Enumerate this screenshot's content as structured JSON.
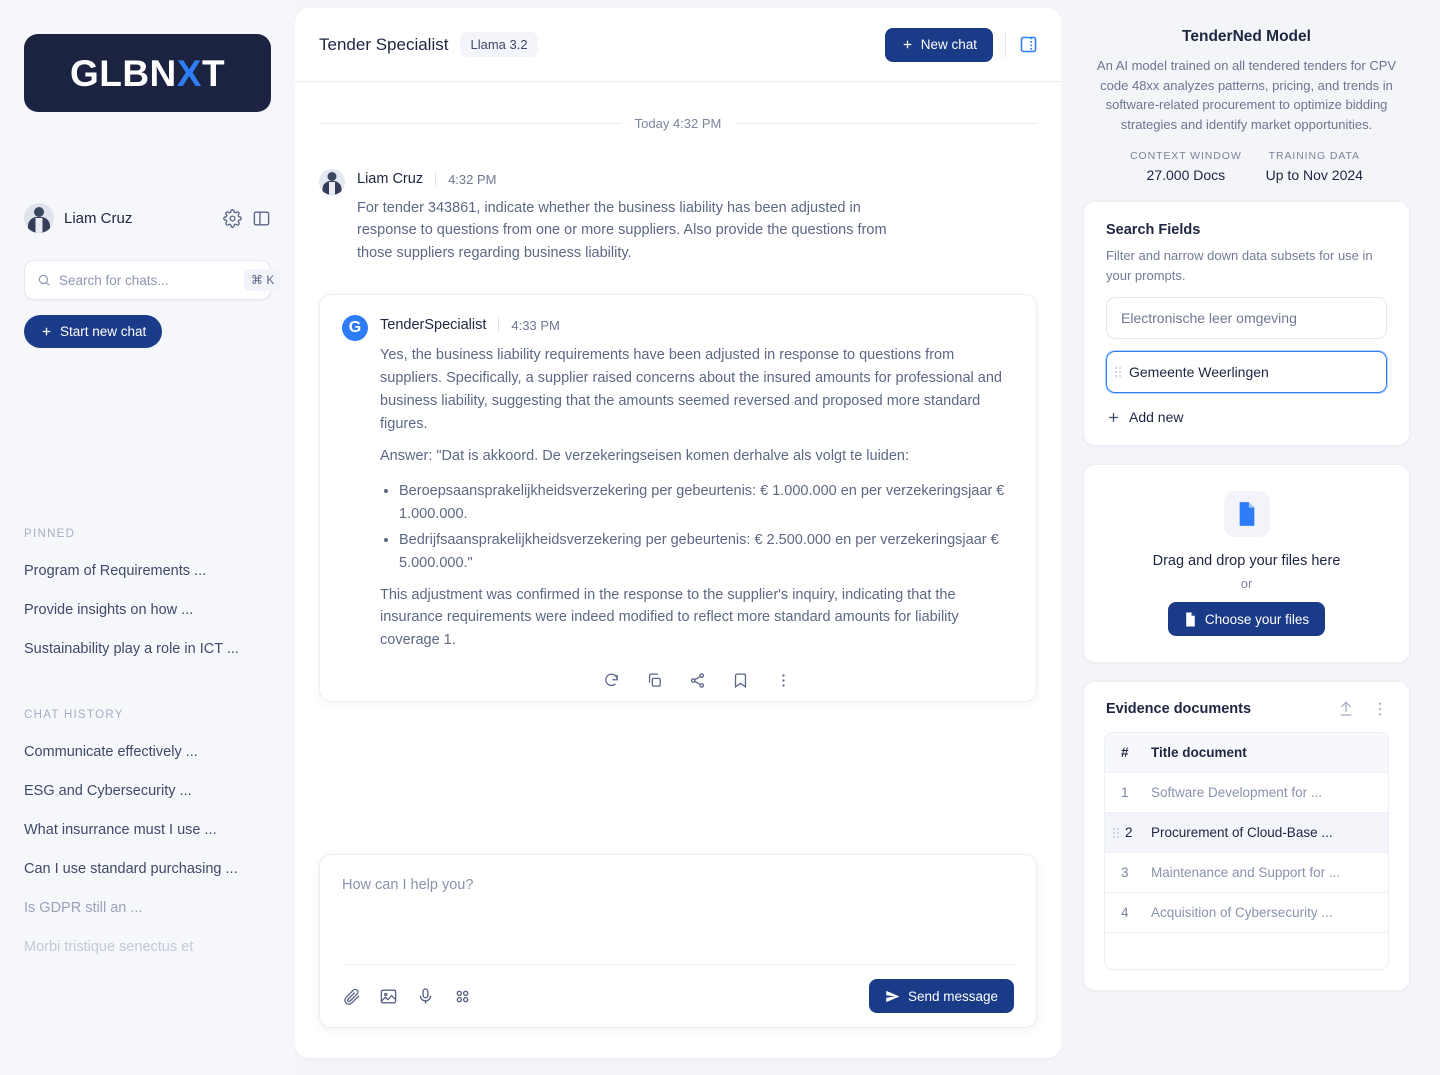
{
  "brand": {
    "logo_main": "GLBN",
    "logo_accent": "X",
    "logo_tail": "T"
  },
  "sidebar": {
    "user": {
      "name": "Liam Cruz"
    },
    "settings_icon": "gear-icon",
    "panel_icon": "panel-toggle-icon",
    "search": {
      "placeholder": "Search for chats...",
      "value": "",
      "shortcut": "⌘ K"
    },
    "start_chat_label": "Start new chat",
    "pinned_label": "PINNED",
    "pinned": [
      "Program of Requirements ...",
      "Provide insights on how ...",
      "Sustainability play a role in ICT ..."
    ],
    "history_label": "CHAT HISTORY",
    "history": [
      "Communicate effectively ...",
      "ESG and Cybersecurity ...",
      "What insurrance must I use ...",
      "Can I use standard purchasing ...",
      "Is GDPR still an ...",
      "Morbi tristique senectus et"
    ]
  },
  "chat": {
    "title": "Tender Specialist",
    "model_badge": "Llama 3.2",
    "new_chat_label": "New chat",
    "day_divider": "Today 4:32 PM",
    "user_message": {
      "author": "Liam Cruz",
      "time": "4:32 PM",
      "text": "For tender 343861, indicate whether the business liability has been adjusted in response to questions from one or more suppliers. Also provide the questions from those suppliers regarding business liability."
    },
    "bot_message": {
      "author": "TenderSpecialist",
      "time": "4:33 PM",
      "logo_letter": "G",
      "paragraph1": "Yes, the business liability requirements have been adjusted in response to questions from suppliers. Specifically, a supplier raised concerns about the insured amounts for professional and business liability, suggesting that the amounts seemed reversed and proposed more standard figures.",
      "paragraph2": "Answer: \"Dat is akkoord. De verzekeringseisen komen derhalve als volgt te luiden:",
      "bullets": [
        "Beroepsaansprakelijkheidsverzekering per gebeurtenis: € 1.000.000 en per verzekeringsjaar € 1.000.000.",
        "Bedrijfsaansprakelijkheidsverzekering per gebeurtenis: € 2.500.000 en per verzekeringsjaar € 5.000.000.\""
      ],
      "paragraph3": "This adjustment was confirmed in the response to the supplier's inquiry, indicating that the insurance requirements were indeed modified to reflect more standard amounts for liability coverage 1.",
      "actions": [
        "regenerate-icon",
        "copy-icon",
        "share-icon",
        "bookmark-icon",
        "more-options-icon"
      ]
    },
    "composer": {
      "placeholder": "How can I help you?",
      "value": "",
      "tools": [
        "attachment-icon",
        "image-icon",
        "microphone-icon",
        "apps-grid-icon"
      ],
      "send_label": "Send message"
    }
  },
  "right_panel": {
    "model": {
      "title": "TenderNed Model",
      "description": "An AI model trained on all tendered tenders for CPV code 48xx analyzes patterns, pricing, and trends in software-related procurement to optimize bidding strategies and identify market opportunities.",
      "stats": [
        {
          "label": "CONTEXT WINDOW",
          "value": "27.000 Docs"
        },
        {
          "label": "TRAINING DATA",
          "value": "Up to Nov 2024"
        }
      ]
    },
    "search_fields": {
      "title": "Search Fields",
      "subtitle": "Filter and narrow down data subsets for use in your prompts.",
      "fields": [
        {
          "value": "Electronische leer omgeving",
          "focused": false
        },
        {
          "value": "Gemeente Weerlingen",
          "focused": true
        }
      ],
      "add_new_label": "Add new"
    },
    "upload": {
      "icon": "file-icon",
      "title": "Drag and drop your files here",
      "or": "or",
      "button_label": "Choose your files"
    },
    "evidence": {
      "title": "Evidence documents",
      "upload_icon": "upload-icon",
      "more_icon": "more-options-icon",
      "columns": [
        "#",
        "Title document"
      ],
      "rows": [
        {
          "num": "1",
          "title": "Software Development for ...",
          "selected": false
        },
        {
          "num": "2",
          "title": "Procurement of Cloud-Base ...",
          "selected": true
        },
        {
          "num": "3",
          "title": "Maintenance and Support for ...",
          "selected": false
        },
        {
          "num": "4",
          "title": "Acquisition of Cybersecurity ...",
          "selected": false
        }
      ]
    }
  },
  "colors": {
    "brand_dark": "#1b2340",
    "accent_blue": "#2f7df6",
    "button_navy": "#1a3b87",
    "page_bg": "#f4f5f9"
  }
}
